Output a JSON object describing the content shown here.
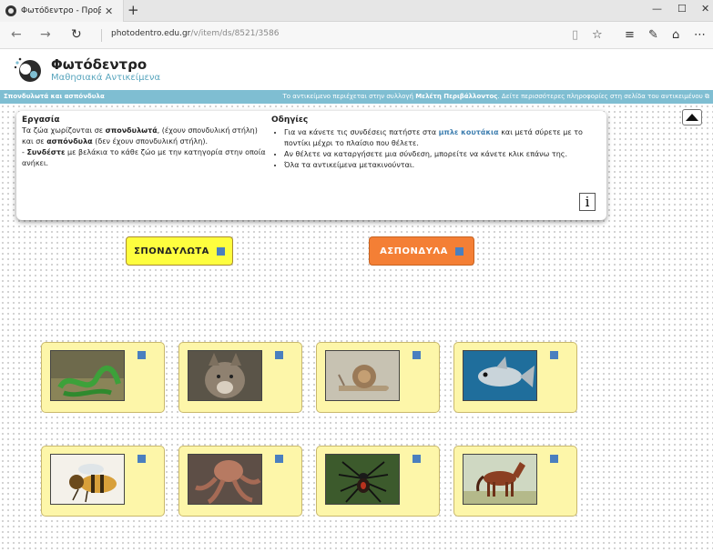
{
  "browser": {
    "tab_title": "Φωτόδεντρο - Προβολ",
    "url_host": "photodentro.edu.gr",
    "url_path": "/v/item/ds/8521/3586"
  },
  "site": {
    "title": "Φωτόδεντρο",
    "subtitle": "Μαθησιακά Αντικείμενα"
  },
  "bar": {
    "left": "Σπονδυλωτά και ασπόνδυλα",
    "right_prefix": "Το αντικείμενο περιέχεται στην συλλογή ",
    "right_collection": "Μελέτη Περιβάλλοντος",
    "right_suffix": ". Δείτε περισσότερες πληροφορίες στη σελίδα του αντικειμένου"
  },
  "task": {
    "heading": "Εργασία",
    "t1": " Τα ζώα χωρίζονται σε ",
    "b1": "σπονδυλωτά",
    "t2": ", (έχουν σπονδυλική στήλη) και σε ",
    "b2": "ασπόνδυλα",
    "t3": " (δεν έχουν σπονδυλική στήλη).",
    "t4": "- ",
    "b3": "Συνδέστε",
    "t5": " με βελάκια το κάθε ζώο με την κατηγορία στην οποία ανήκει."
  },
  "guide": {
    "heading": "Οδηγίες",
    "i1a": "Για να κάνετε τις συνδέσεις πατήστε στα ",
    "i1b": "μπλε κουτάκια",
    "i1c": " και μετά σύρετε με το ποντίκι μέχρι το πλαίσιο που θέλετε.",
    "i2": "Αν θέλετε να καταργήσετε μια σύνδεση, μπορείτε να κάνετε κλικ επάνω της.",
    "i3": "Όλα τα αντικείμενα μετακινούνται."
  },
  "info_label": "i",
  "categories": {
    "vertebrates": "ΣΠΟΝΔΥΛΩΤΑ",
    "invertebrates": "ΑΣΠΟΝΔΥΛΑ"
  },
  "colors": {
    "connector": "#4a7fbf",
    "card_bg": "#fdf6a9",
    "vertebrates_bg": "#fefe3e",
    "invertebrates_bg": "#f47f35",
    "bar": "#7fbed2"
  },
  "animals": [
    "snake",
    "wolf",
    "snail",
    "fish",
    "bee",
    "octopus",
    "spider",
    "horse"
  ]
}
